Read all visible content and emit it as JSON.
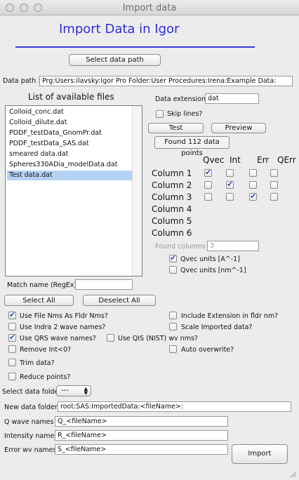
{
  "window": {
    "title": "Import data"
  },
  "heading": "Import Data in Igor",
  "select_data_path_button": "Select data path",
  "data_path": {
    "label": "Data path :",
    "value": "Prg:Users:ilavsky:Igor Pro Folder:User Procedures:Irena:Example Data:"
  },
  "file_list": {
    "title": "List of available files",
    "items": [
      "Colloid_conc.dat",
      "Colloid_dilute.dat",
      "PDDF_testData_GnomPr.dat",
      "PDDF_testData_SAS.dat",
      "smeared data.dat",
      "Spheres330ADia_modelData.dat",
      "Test data.dat"
    ],
    "selected_index": 6
  },
  "data_extension": {
    "label": "Data extension:",
    "value": "dat"
  },
  "skip_lines": {
    "label": "Skip lines?",
    "checked": false
  },
  "test_button": "Test",
  "preview_button": "Preview",
  "found_points": "Found 112 data points",
  "columns": {
    "headers": [
      "Qvec",
      "Int",
      "Err",
      "QErr"
    ],
    "rows": [
      {
        "label": "Column 1",
        "checks": [
          true,
          false,
          false,
          false
        ]
      },
      {
        "label": "Column 2",
        "checks": [
          false,
          true,
          false,
          false
        ]
      },
      {
        "label": "Column 3",
        "checks": [
          false,
          false,
          true,
          false
        ]
      },
      {
        "label": "Column 4"
      },
      {
        "label": "Column 5"
      },
      {
        "label": "Column 6"
      }
    ]
  },
  "found_columns": {
    "label": "Found columns :",
    "value": "3"
  },
  "qvec_units": [
    {
      "label": "Qvec units [A^-1]",
      "checked": true
    },
    {
      "label": "Qvec units [nm^-1]",
      "checked": false
    }
  ],
  "match_name": {
    "label": "Match name (RegEx):",
    "value": ""
  },
  "select_all_button": "Select All",
  "deselect_all_button": "Deselect All",
  "options": {
    "use_file_nms": {
      "label": "Use File Nms As Fldr Nms?",
      "checked": true
    },
    "use_indra2": {
      "label": "Use Indra 2 wave names?",
      "checked": false
    },
    "use_qrs": {
      "label": "Use QRS wave names?",
      "checked": true
    },
    "use_qis": {
      "label": "Use QIS (NIST) wv nms?",
      "checked": false
    },
    "remove_int": {
      "label": "Remove Int<0?",
      "checked": false
    },
    "trim_data": {
      "label": "Trim data?",
      "checked": false
    },
    "reduce_points": {
      "label": "Reduce points?",
      "checked": false
    },
    "include_extension": {
      "label": "Include Extension in fldr nm?",
      "checked": false
    },
    "scale_imported": {
      "label": "Scale Imported data?",
      "checked": false
    },
    "auto_overwrite": {
      "label": "Auto overwrite?",
      "checked": false
    }
  },
  "select_data_folder": {
    "label": "Select data folder",
    "value": "---"
  },
  "new_data_folder": {
    "label": "New data folder:",
    "value": "root:SAS:ImportedData:<fileName>:"
  },
  "q_wave_names": {
    "label": "Q wave names",
    "value": "Q_<fileName>"
  },
  "intensity_names": {
    "label": "Intensity names",
    "value": "R_<fileName>"
  },
  "error_wv_names": {
    "label": "Error wv names",
    "value": "S_<fileName>"
  },
  "import_button": "Import",
  "colors": {
    "heading": "#2e2ed6",
    "selection": "#b5d2f5",
    "check": "#2b56b8"
  }
}
